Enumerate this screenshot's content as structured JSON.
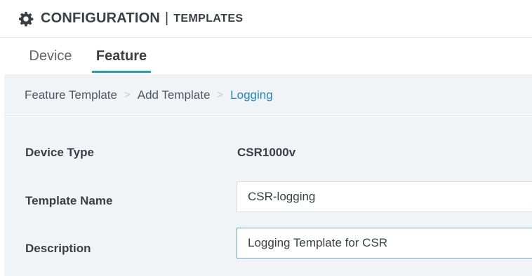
{
  "header": {
    "title": "CONFIGURATION",
    "separator": "|",
    "subtitle": "TEMPLATES",
    "icon": "gear-icon"
  },
  "tabs": [
    {
      "label": "Device",
      "active": false
    },
    {
      "label": "Feature",
      "active": true
    }
  ],
  "breadcrumb": {
    "items": [
      "Feature Template",
      "Add Template",
      "Logging"
    ],
    "separator": ">"
  },
  "form": {
    "device_type": {
      "label": "Device Type",
      "value": "CSR1000v"
    },
    "template_name": {
      "label": "Template Name",
      "value": "CSR-logging"
    },
    "description": {
      "label": "Description",
      "value": "Logging Template for CSR"
    }
  },
  "colors": {
    "accent_tab": "#1ba3b3",
    "breadcrumb_active": "#1e88c8",
    "panel_bg": "#f1f4f7"
  }
}
